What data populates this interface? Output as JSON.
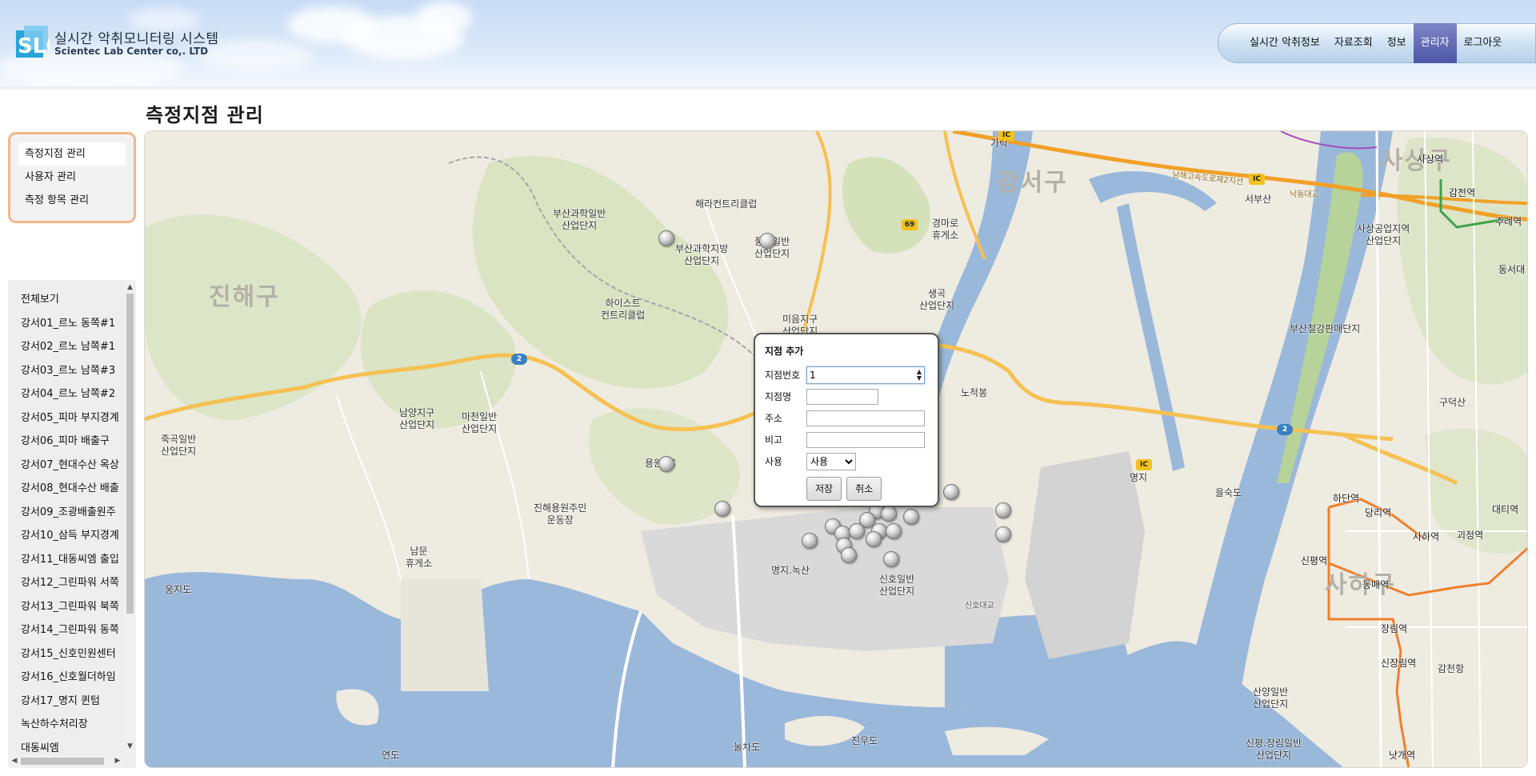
{
  "header": {
    "logo_text": "SLC",
    "title": "실시간 악취모니터링 시스템",
    "subtitle": "Scientec Lab Center co,. LTD"
  },
  "topnav": {
    "items": [
      {
        "label": "실시간 악취정보",
        "active": false
      },
      {
        "label": "자료조회",
        "active": false
      },
      {
        "label": "정보",
        "active": false
      },
      {
        "label": "관리자",
        "active": true
      },
      {
        "label": "로그아웃",
        "active": false
      }
    ]
  },
  "page_title": "측정지점 관리",
  "left_menu": {
    "items": [
      {
        "label": "측정지점 관리",
        "active": true
      },
      {
        "label": "사용자 관리",
        "active": false
      },
      {
        "label": "측정 항목 관리",
        "active": false
      }
    ]
  },
  "station_list": {
    "items": [
      "전체보기",
      "강서01_르노 동쪽#1",
      "강서02_르노 남쪽#1",
      "강서03_르노 남쪽#3",
      "강서04_르노 남쪽#2",
      "강서05_피마 부지경계",
      "강서06_피마 배출구",
      "강서07_현대수산 옥상",
      "강서08_현대수산 배출",
      "강서09_조광배출원주",
      "강서10_삼득 부지경계",
      "강서11_대동씨엠 출입",
      "강서12_그린파워 서쪽",
      "강서13_그린파워 북쪽",
      "강서14_그린파워 동쪽",
      "강서15_신호민원센터",
      "강서16_신호월더하임",
      "강서17_명지 퀸텀",
      "녹산하수처리장",
      "대동씨엠"
    ]
  },
  "map": {
    "labels": {
      "jinhae": "진해구",
      "gangseo": "강서구",
      "sasang": "사상구",
      "saha": "사하구",
      "science_park": "부산과학일반\n산업단지",
      "science_local": "부산과학지방\n산업단지",
      "haera_cc": "해라컨트리클럽",
      "pungsang": "풍상일반\n산업단지",
      "highest_cc": "하이스트\n컨트리클럽",
      "mieum": "미음지구\n산업단지",
      "saenggok": "생곡\n산업단지",
      "gyeongma": "경마로\n휴게소",
      "nojeokbong": "노적봉",
      "namyang": "남양지구\n산업단지",
      "macheon": "마천일반\n산업단지",
      "jukgok": "죽곡일반\n산업단지",
      "yongwon_cc": "용원CC",
      "jinhae_yongwon": "진해용원주민\n운동장",
      "nammun": "남문\n휴게소",
      "ungjido": "웅지도",
      "myeongji_noksan": "명지.녹산",
      "sinho": "신호일반\n산업단지",
      "yeondo": "연도",
      "nulchado": "눌차도",
      "jinudo": "진우도",
      "gara": "가락",
      "myeongji": "명지",
      "eulsukdo": "을숙도",
      "seobusan": "서부산",
      "sasang_industrial": "사상공업지역\n산업단지",
      "busan_steel": "부산철강판매단지",
      "gudeoksan": "구덕산",
      "sinpyeong_jangrim": "신평.장림일반\n산업단지",
      "sanyang": "산양일반\n산업단지",
      "gamcheon": "감천항",
      "namhae_exp": "남해고속도로제2지선",
      "nakdong_bridge": "낙동대교",
      "sinho_bridge": "신호대교"
    },
    "stations": {
      "sasang": "사상역",
      "gamjeon": "감전역",
      "jurye": "주례역",
      "dongseo": "동서대",
      "hadan": "하단역",
      "dangni": "당리역",
      "saha": "사하역",
      "goejeong": "괴정역",
      "daeti": "대티역",
      "sinpyeong": "신평역",
      "dongmae": "동매역",
      "jangrim": "장림역",
      "sinjangrim": "신장림역",
      "natgae": "낫개역"
    },
    "shields": {
      "ic": "IC",
      "r2": "2",
      "r69": "69"
    },
    "colors": {
      "water": "#9ab8da",
      "land": "#eeebe1",
      "green": "#cfe0b4",
      "road_major": "#f5b942",
      "metro_line": "#f07f2b"
    }
  },
  "popup": {
    "title": "지점 추가",
    "fields": {
      "station_no_label": "지점번호",
      "station_no_value": "1",
      "station_name_label": "지점명",
      "station_name_value": "",
      "address_label": "주소",
      "address_value": "",
      "note_label": "비고",
      "note_value": "",
      "use_label": "사용",
      "use_value": "사용"
    },
    "save_label": "저장",
    "cancel_label": "취소"
  }
}
